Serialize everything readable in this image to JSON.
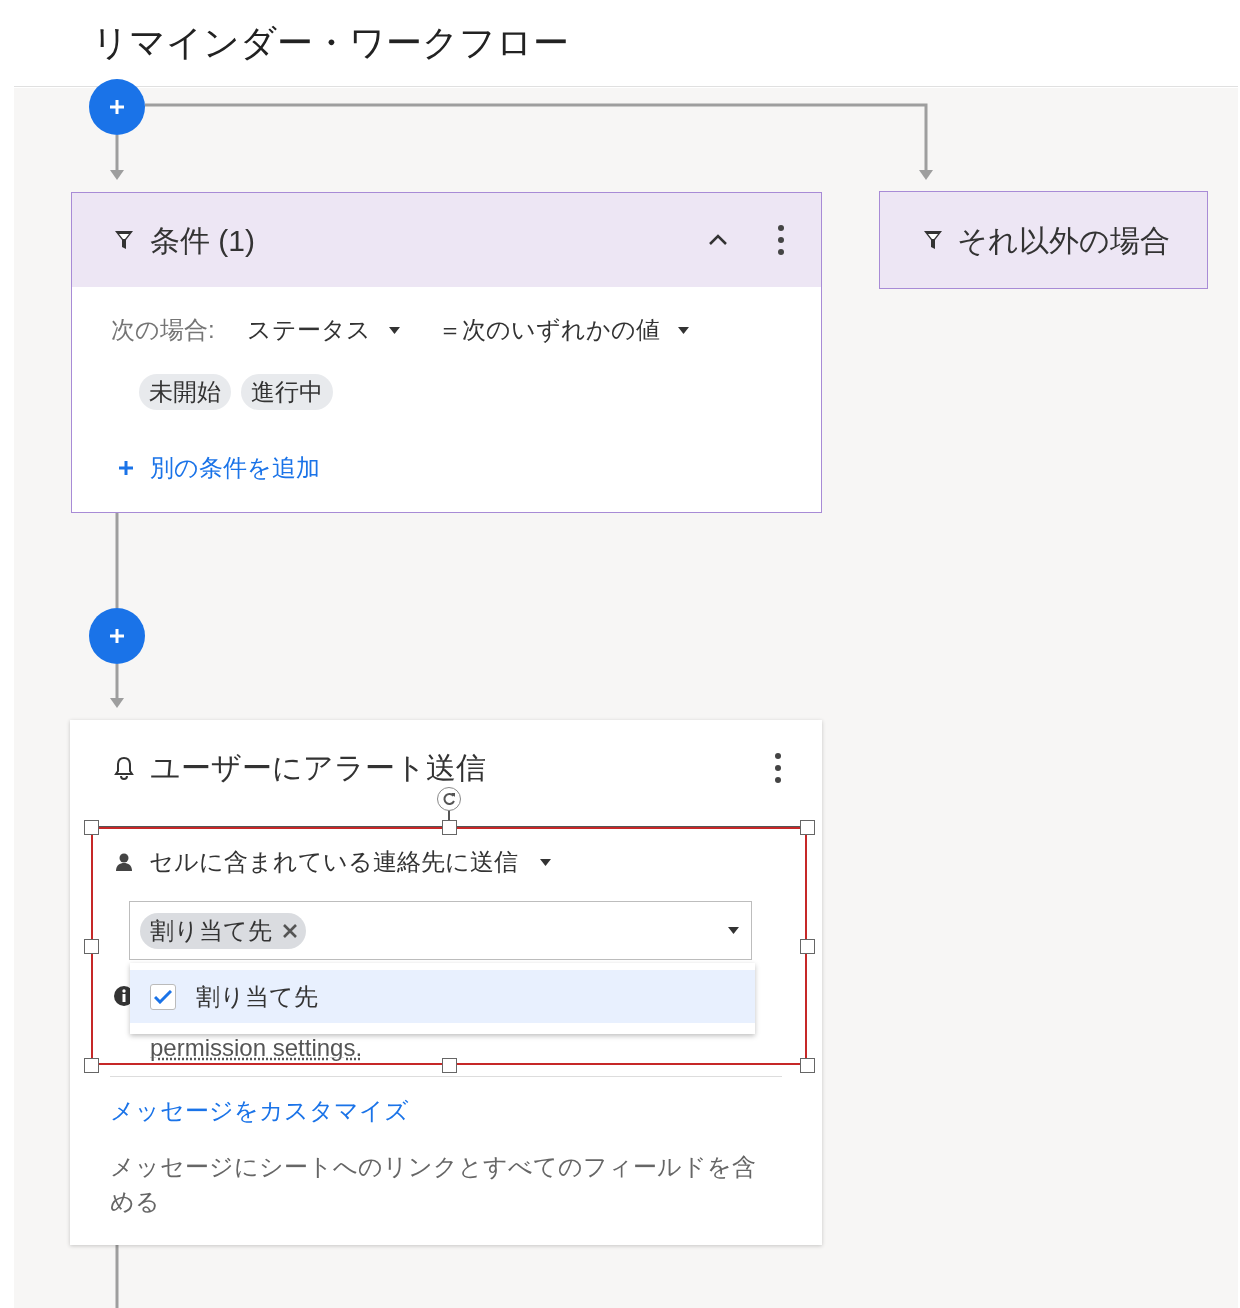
{
  "title": "リマインダー・ワークフロー",
  "condition_card": {
    "title": "条件 (1)",
    "expanded": true,
    "if_label": "次の場合:",
    "field": "ステータス",
    "operator": "＝次のいずれかの値",
    "values": [
      "未開始",
      "進行中"
    ],
    "add_link": "別の条件を追加"
  },
  "else_card": {
    "title": "それ以外の場合"
  },
  "alert_card": {
    "title": "ユーザーにアラート送信",
    "recipient_mode": "セルに含まれている連絡先に送信",
    "selected_chips": [
      "割り当て先"
    ],
    "dropdown_options": [
      {
        "label": "割り当て先",
        "checked": true
      }
    ],
    "note": "permission settings.",
    "customize_link": "メッセージをカスタマイズ",
    "description": "メッセージにシートへのリンクとすべてのフィールドを含める"
  }
}
